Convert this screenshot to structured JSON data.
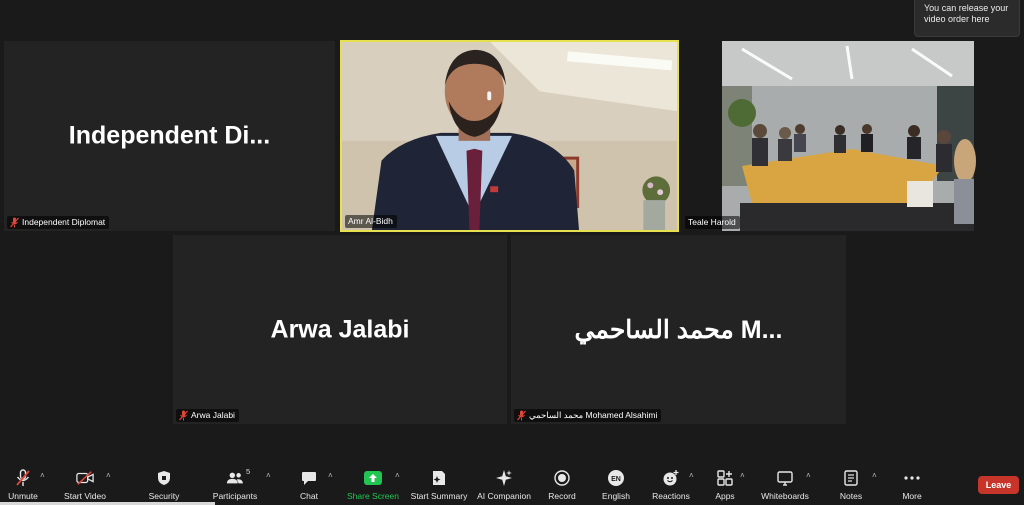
{
  "tooltip": {
    "text": "You can release your video order here"
  },
  "tiles": [
    {
      "display_name": "Independent  Di...",
      "label": "Independent Diplomat",
      "muted": true
    },
    {
      "display_name": "",
      "label": "Amr Al-Bidh",
      "muted": false,
      "active_speaker": true,
      "highlight_color": "#e6e24f"
    },
    {
      "display_name": "",
      "label": "Teale Harold",
      "muted": false
    },
    {
      "display_name": "Arwa Jalabi",
      "label": "Arwa Jalabi",
      "muted": true
    },
    {
      "display_name": "محمد الساحمي M...",
      "label": "محمد الساحمي Mohamed Alsahimi",
      "muted": true
    }
  ],
  "toolbar": {
    "unmute": "Unmute",
    "start_video": "Start Video",
    "security": "Security",
    "participants": "Participants",
    "participants_count": "5",
    "chat": "Chat",
    "share_screen": "Share Screen",
    "start_summary": "Start Summary",
    "ai_companion": "AI Companion",
    "record": "Record",
    "english": "English",
    "english_badge": "EN",
    "reactions": "Reactions",
    "apps": "Apps",
    "whiteboards": "Whiteboards",
    "notes": "Notes",
    "more": "More",
    "leave": "Leave"
  },
  "colors": {
    "share_green": "#23c552",
    "leave_red": "#c7352a",
    "mic_off_red": "#e0463a",
    "speaker_border": "#e6e24f"
  }
}
